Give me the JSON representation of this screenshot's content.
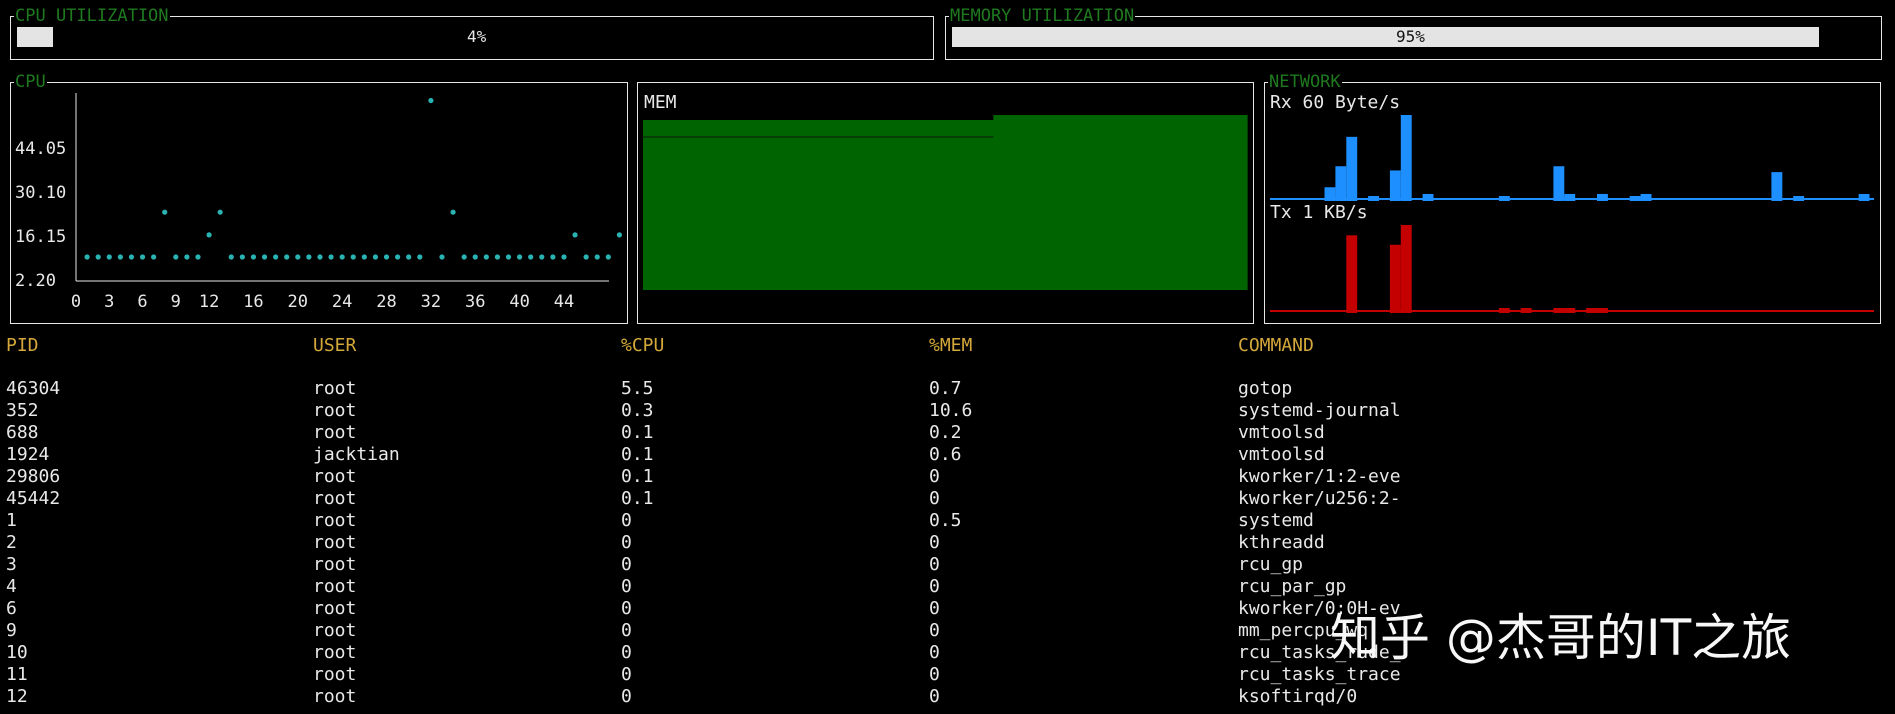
{
  "cpu_utilization": {
    "title": "CPU UTILIZATION",
    "percent": 4,
    "label": "4%"
  },
  "memory_utilization": {
    "title": "MEMORY UTILIZATION",
    "percent": 95,
    "label": "95%"
  },
  "cpu_panel": {
    "title": "CPU",
    "y_tick_labels": [
      "2.20",
      "16.15",
      "30.10",
      "44.05"
    ],
    "x_tick_labels": [
      "0",
      "3",
      "6",
      "9",
      "12",
      "16",
      "20",
      "24",
      "28",
      "32",
      "36",
      "40",
      "44"
    ]
  },
  "mem_panel": {
    "label": "MEM"
  },
  "network_panel": {
    "title": "NETWORK",
    "rx_label": "Rx 60 Byte/s",
    "tx_label": "Tx 1 KB/s"
  },
  "colors": {
    "title_green": "#1f7a1f",
    "cpu_dots": "#2ab3b3",
    "mem_fill": "#006400",
    "rx": "#1e8fff",
    "tx": "#c40000",
    "header": "#d4a83a"
  },
  "chart_data": [
    {
      "type": "scatter",
      "title": "CPU",
      "y_ticks": [
        2.2,
        16.15,
        30.1,
        44.05
      ],
      "x_ticks": [
        0,
        3,
        6,
        9,
        12,
        16,
        20,
        24,
        28,
        32,
        36,
        40,
        44
      ],
      "xlim": [
        0,
        48
      ],
      "series": [
        {
          "x": [
            1,
            2,
            3,
            4,
            5,
            6,
            7,
            8,
            9,
            10,
            11,
            12,
            13,
            14,
            15,
            16,
            17,
            18,
            19,
            20,
            21,
            22,
            23,
            24,
            25,
            26,
            27,
            28,
            29,
            30,
            31,
            32,
            33,
            34,
            35,
            36,
            37,
            38,
            39,
            40,
            41,
            42,
            43,
            44,
            45,
            46,
            47,
            48,
            49
          ],
          "y": [
            9.5,
            9.5,
            9.5,
            9.5,
            9.5,
            9.5,
            9.5,
            23.7,
            9.5,
            9.5,
            9.5,
            16.5,
            23.7,
            9.5,
            9.5,
            9.5,
            9.5,
            9.5,
            9.5,
            9.5,
            9.5,
            9.5,
            9.5,
            9.5,
            9.5,
            9.5,
            9.5,
            9.5,
            9.5,
            9.5,
            9.5,
            59.1,
            9.5,
            23.7,
            9.5,
            9.5,
            9.5,
            9.5,
            9.5,
            9.5,
            9.5,
            9.5,
            9.5,
            9.5,
            16.5,
            9.5,
            9.5,
            9.5,
            16.5
          ]
        }
      ]
    },
    {
      "type": "area",
      "title": "MEM",
      "values_percent": [
        94,
        94,
        94,
        94,
        94,
        94,
        94,
        94,
        94,
        94,
        94,
        94,
        94,
        94,
        94,
        94,
        94,
        94,
        94,
        94,
        94,
        94,
        94,
        94,
        94,
        94,
        94,
        94,
        94,
        95,
        95,
        95,
        95,
        95,
        95,
        95,
        95,
        95,
        95,
        95,
        95,
        95,
        95,
        95,
        95,
        95,
        95,
        95,
        95,
        95
      ]
    },
    {
      "type": "bar",
      "title": "NETWORK",
      "series": [
        {
          "name": "Rx 60 Byte/s",
          "values_relative": [
            0,
            0,
            0,
            0,
            0,
            0.14,
            0.39,
            0.74,
            0,
            0.03,
            0,
            0.34,
            1.0,
            0,
            0.06,
            0,
            0,
            0,
            0,
            0,
            0,
            0.03,
            0,
            0,
            0,
            0,
            0.39,
            0.06,
            0,
            0,
            0.06,
            0,
            0,
            0.03,
            0.06,
            0,
            0,
            0,
            0,
            0,
            0,
            0,
            0,
            0,
            0,
            0,
            0.32,
            0,
            0.03,
            0,
            0,
            0,
            0,
            0,
            0.06
          ]
        },
        {
          "name": "Tx 1 KB/s",
          "values_relative": [
            0,
            0,
            0,
            0,
            0,
            0,
            0,
            0.88,
            0,
            0,
            0,
            0.77,
            1.0,
            0,
            0,
            0,
            0,
            0,
            0,
            0,
            0,
            0.03,
            0,
            0.03,
            0,
            0,
            0.03,
            0.03,
            0,
            0.03,
            0.03,
            0,
            0,
            0,
            0,
            0,
            0,
            0,
            0,
            0,
            0,
            0,
            0,
            0,
            0,
            0,
            0,
            0,
            0,
            0,
            0,
            0,
            0,
            0,
            0
          ]
        }
      ]
    }
  ],
  "process_table": {
    "headers": [
      "PID",
      "USER",
      "%CPU",
      "%MEM",
      "COMMAND"
    ],
    "rows": [
      [
        "46304",
        "root",
        "5.5",
        "0.7",
        "gotop"
      ],
      [
        "352",
        "root",
        "0.3",
        "10.6",
        "systemd-journal"
      ],
      [
        "688",
        "root",
        "0.1",
        "0.2",
        "vmtoolsd"
      ],
      [
        "1924",
        "jacktian",
        "0.1",
        "0.6",
        "vmtoolsd"
      ],
      [
        "29806",
        "root",
        "0.1",
        "0",
        "kworker/1:2-eve"
      ],
      [
        "45442",
        "root",
        "0.1",
        "0",
        "kworker/u256:2-"
      ],
      [
        "1",
        "root",
        "0",
        "0.5",
        "systemd"
      ],
      [
        "2",
        "root",
        "0",
        "0",
        "kthreadd"
      ],
      [
        "3",
        "root",
        "0",
        "0",
        "rcu_gp"
      ],
      [
        "4",
        "root",
        "0",
        "0",
        "rcu_par_gp"
      ],
      [
        "6",
        "root",
        "0",
        "0",
        "kworker/0:0H-ev"
      ],
      [
        "9",
        "root",
        "0",
        "0",
        "mm_percpu_wq"
      ],
      [
        "10",
        "root",
        "0",
        "0",
        "rcu_tasks_rude_"
      ],
      [
        "11",
        "root",
        "0",
        "0",
        "rcu_tasks_trace"
      ],
      [
        "12",
        "root",
        "0",
        "0",
        "ksoftirqd/0"
      ]
    ]
  },
  "watermark": "知乎 @杰哥的IT之旅"
}
